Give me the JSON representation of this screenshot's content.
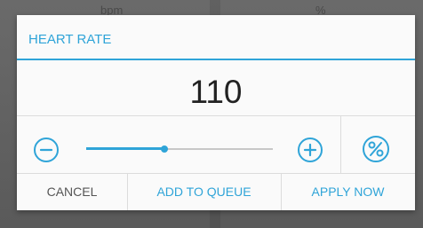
{
  "background": {
    "left_label": "bpm",
    "right_label": "%"
  },
  "dialog": {
    "title": "HEART RATE",
    "value": "110",
    "slider": {
      "level": 0.42
    },
    "icons": {
      "decrease": "minus-circle-icon",
      "increase": "plus-circle-icon",
      "percent": "percent-circle-icon"
    },
    "actions": {
      "cancel": "CANCEL",
      "add_to_queue": "ADD TO QUEUE",
      "apply_now": "APPLY NOW"
    }
  },
  "colors": {
    "accent": "#2fa4d8",
    "text": "#222222",
    "muted_text": "#555555"
  }
}
